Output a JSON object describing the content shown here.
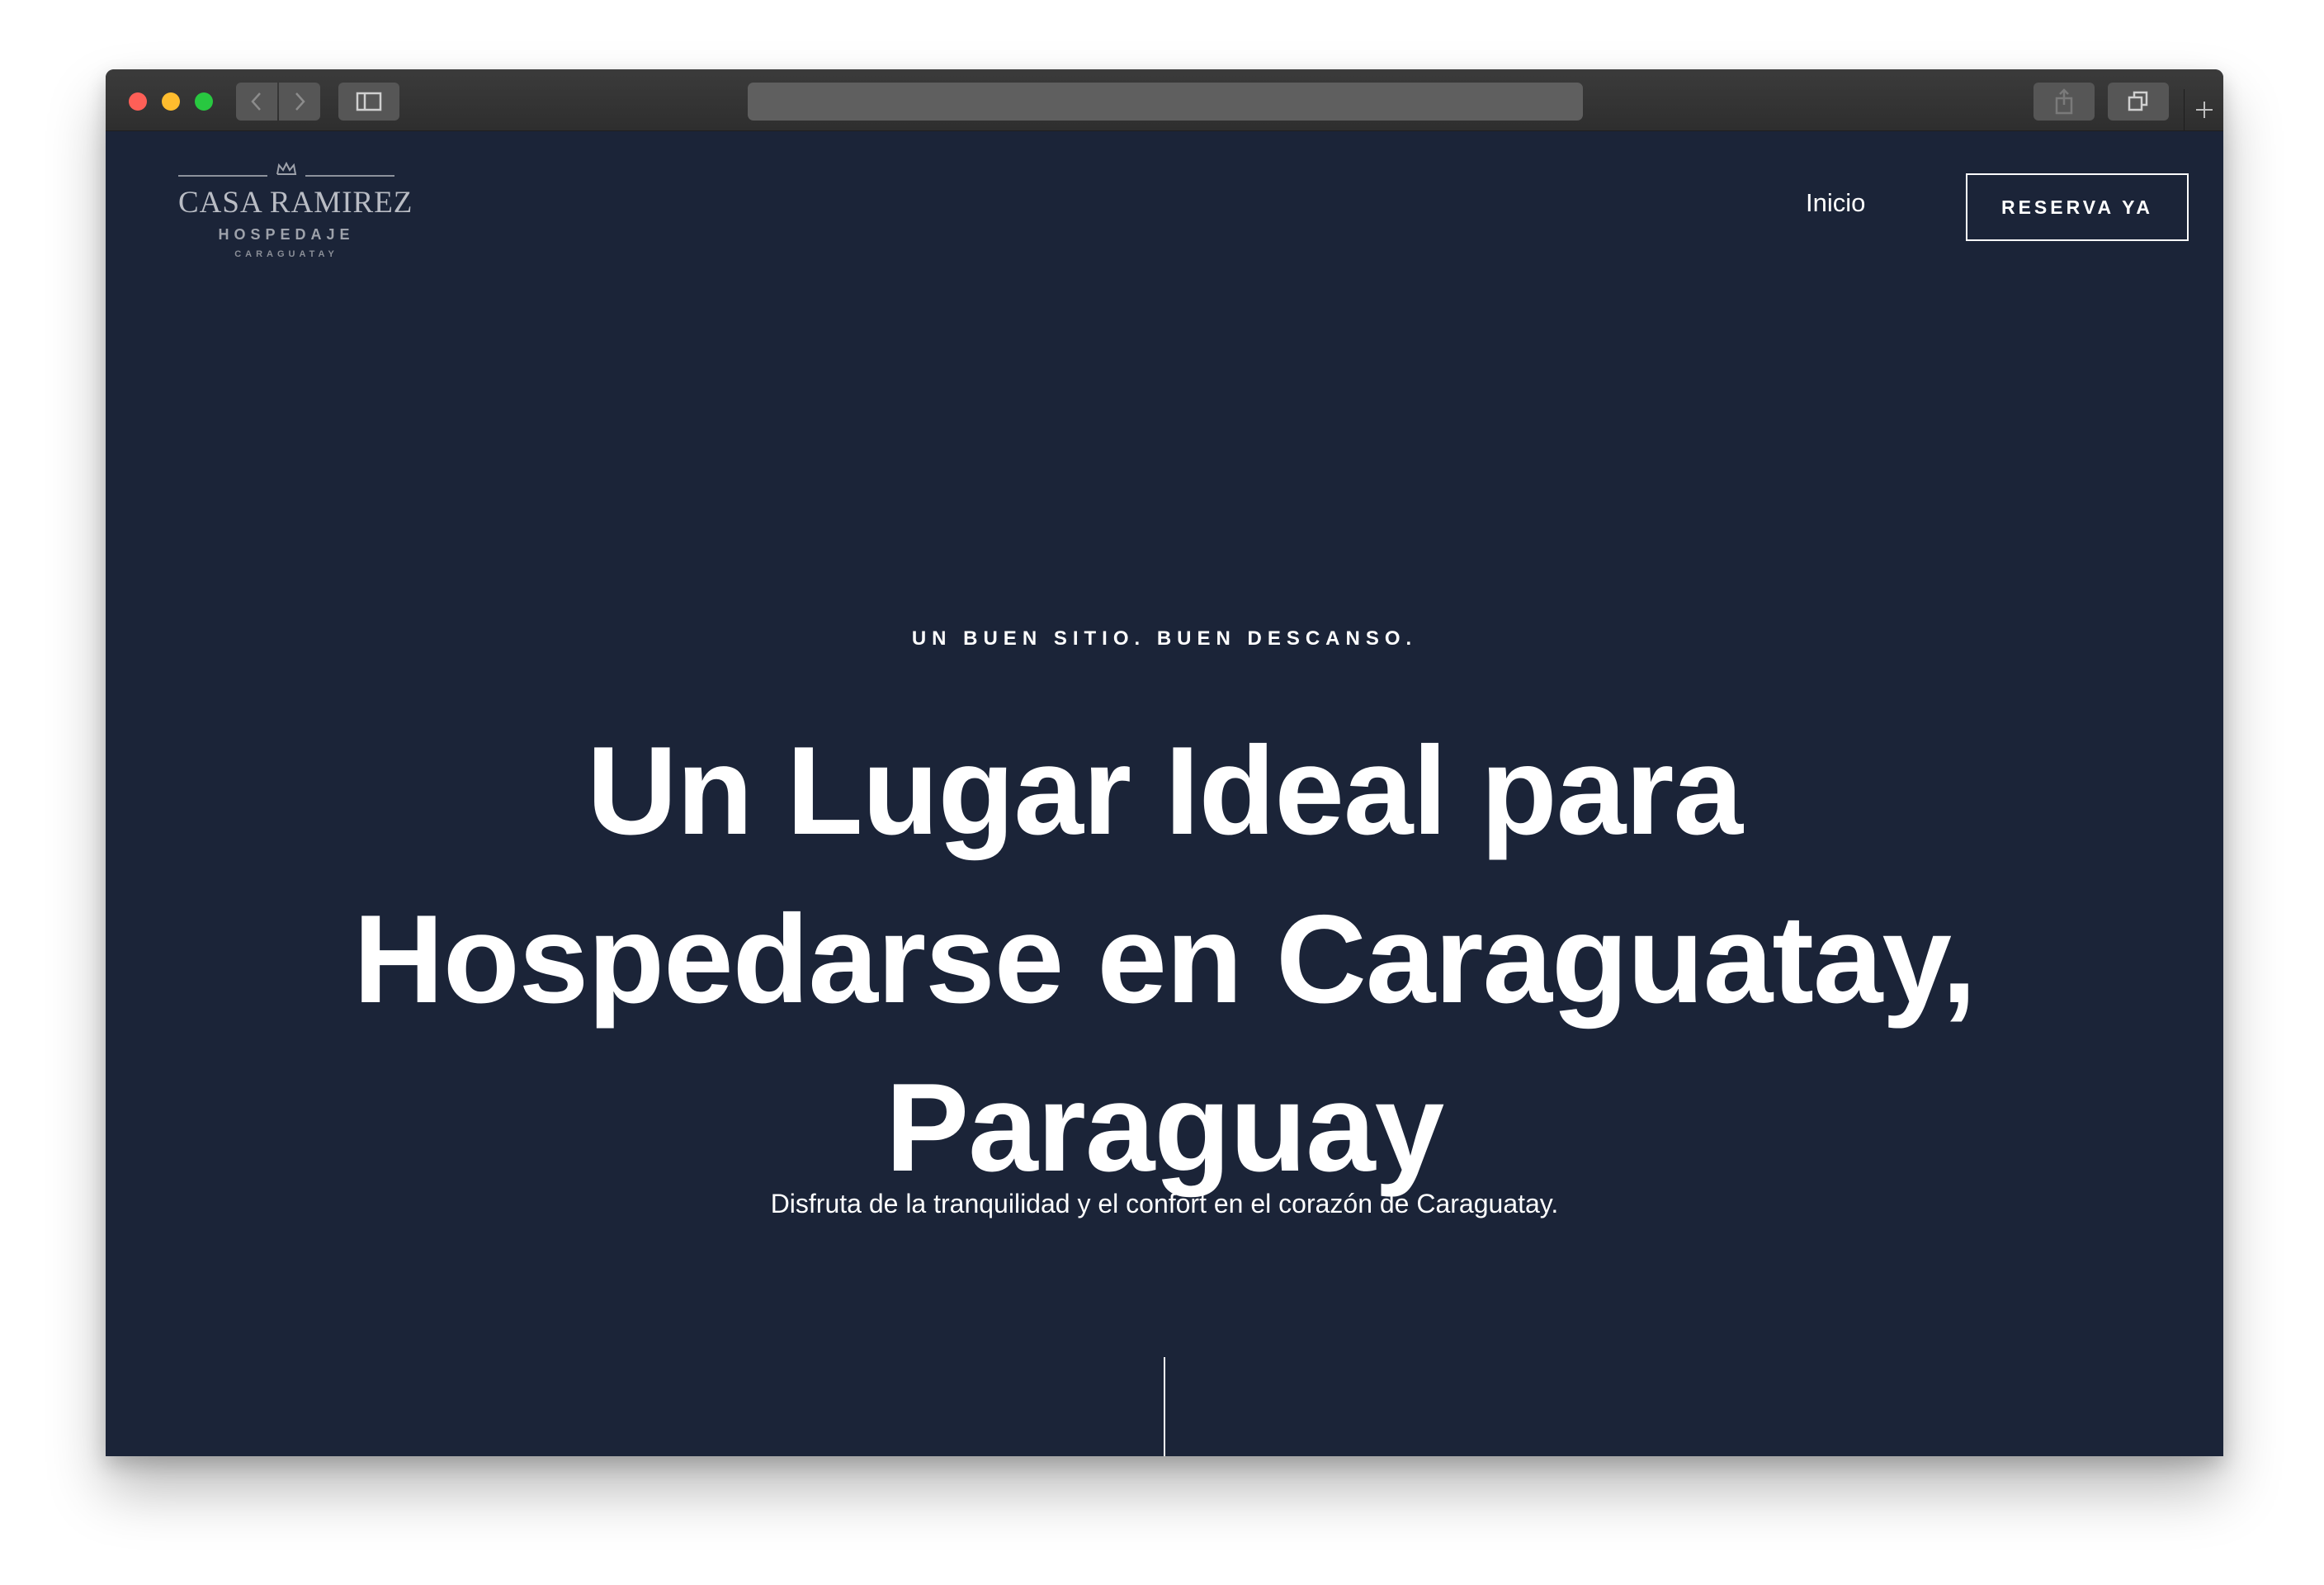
{
  "browser": {
    "back_icon": "chevron-left-icon",
    "forward_icon": "chevron-right-icon",
    "sidebar_icon": "sidebar-icon",
    "share_icon": "share-icon",
    "tabs_icon": "tabs-icon",
    "new_tab_icon": "plus-icon",
    "url": ""
  },
  "header": {
    "logo": {
      "name": "CASA RAMIREZ",
      "subtitle": "HOSPEDAJE",
      "location": "CARAGUATAY",
      "icon": "crown-icon"
    },
    "nav": {
      "inicio_label": "Inicio",
      "cta_label": "RESERVA YA"
    }
  },
  "hero": {
    "eyebrow": "UN BUEN SITIO. BUEN DESCANSO.",
    "headline": "Un Lugar Ideal para Hospedarse en Caraguatay, Paraguay",
    "subtext": "Disfruta de la tranquilidad y el confort en el corazón de Caraguatay."
  },
  "colors": {
    "page_background": "#1b2438",
    "text": "#ffffff",
    "logo_text": "#b9bcc4"
  }
}
